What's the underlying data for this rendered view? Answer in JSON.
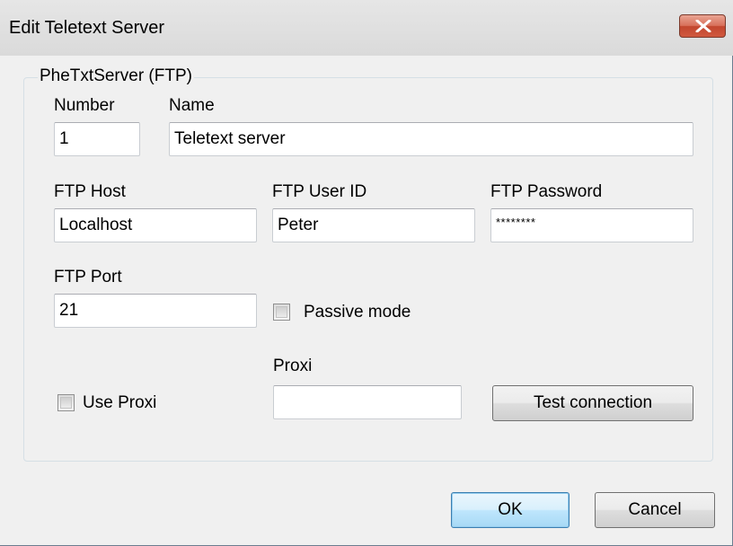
{
  "window": {
    "title": "Edit Teletext Server"
  },
  "group": {
    "legend": "PheTxtServer (FTP)"
  },
  "fields": {
    "number": {
      "label": "Number",
      "value": "1"
    },
    "name": {
      "label": "Name",
      "value": "Teletext server"
    },
    "ftp_host": {
      "label": "FTP Host",
      "value": "Localhost"
    },
    "ftp_user": {
      "label": "FTP User ID",
      "value": "Peter"
    },
    "ftp_password": {
      "label": "FTP Password",
      "value": "********"
    },
    "ftp_port": {
      "label": "FTP Port",
      "value": "21"
    },
    "proxi": {
      "label": "Proxi",
      "value": ""
    }
  },
  "checkboxes": {
    "passive_mode": {
      "label": "Passive mode",
      "checked": false
    },
    "use_proxi": {
      "label": "Use Proxi",
      "checked": false
    }
  },
  "buttons": {
    "test_connection": "Test connection",
    "ok": "OK",
    "cancel": "Cancel"
  },
  "colors": {
    "close_button": "#c7503a",
    "default_button": "#bee6fd",
    "dialog_background": "#f0f0f0"
  }
}
